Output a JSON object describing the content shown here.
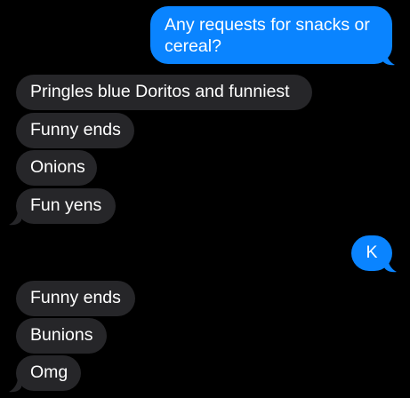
{
  "conversation": {
    "messages": [
      {
        "direction": "outgoing",
        "text": "Any requests for snacks or cereal?"
      },
      {
        "direction": "incoming",
        "text": "Pringles blue Doritos and funniest"
      },
      {
        "direction": "incoming",
        "text": "Funny ends"
      },
      {
        "direction": "incoming",
        "text": "Onions"
      },
      {
        "direction": "incoming",
        "text": "Fun yens"
      },
      {
        "direction": "outgoing",
        "text": "K"
      },
      {
        "direction": "incoming",
        "text": "Funny ends"
      },
      {
        "direction": "incoming",
        "text": "Bunions"
      },
      {
        "direction": "incoming",
        "text": "Omg"
      }
    ]
  },
  "colors": {
    "background": "#000000",
    "outgoing_bubble": "#0a84ff",
    "incoming_bubble": "#262629",
    "text": "#ffffff"
  }
}
